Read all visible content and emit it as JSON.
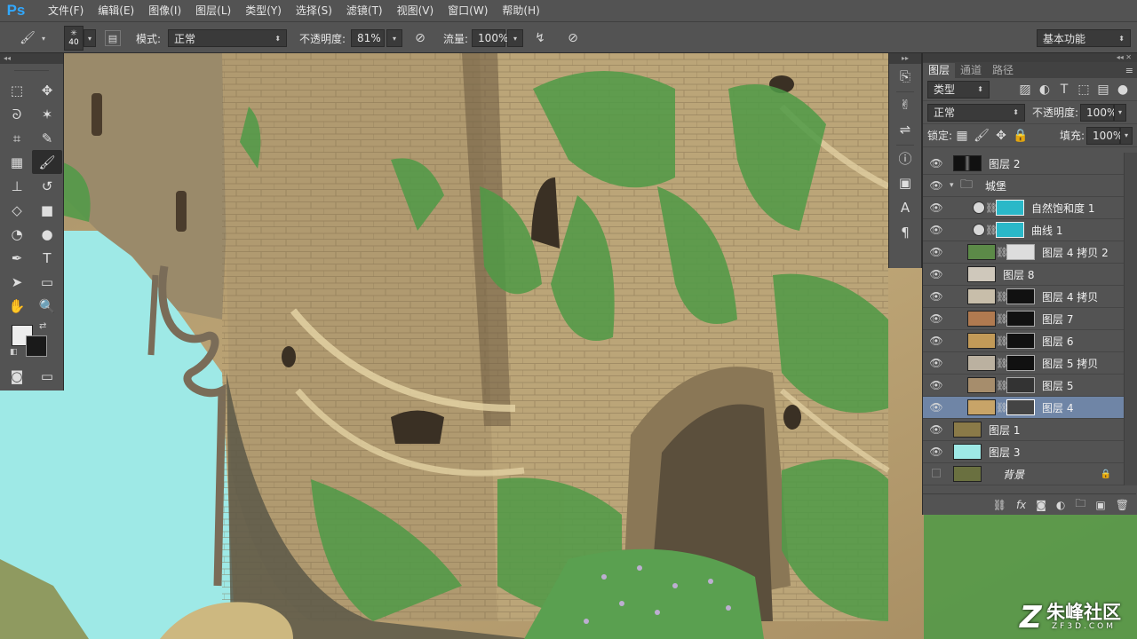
{
  "app": {
    "logo": "Ps"
  },
  "menu": [
    "文件(F)",
    "编辑(E)",
    "图像(I)",
    "图层(L)",
    "类型(Y)",
    "选择(S)",
    "滤镜(T)",
    "视图(V)",
    "窗口(W)",
    "帮助(H)"
  ],
  "options": {
    "brush_size": "40",
    "mode_label": "模式:",
    "mode_value": "正常",
    "opacity_label": "不透明度:",
    "opacity_value": "81%",
    "flow_label": "流量:",
    "flow_value": "100%",
    "workspace": "基本功能"
  },
  "layers_panel": {
    "tabs": [
      "图层",
      "通道",
      "路径"
    ],
    "filter_kind": "类型",
    "blend_mode": "正常",
    "opacity_label": "不透明度:",
    "opacity_value": "100%",
    "lock_label": "锁定:",
    "fill_label": "填充:",
    "fill_value": "100%",
    "layers": [
      {
        "name": "图层 2",
        "visible": true
      },
      {
        "name": "城堡",
        "visible": true,
        "type": "group"
      },
      {
        "name": "自然饱和度 1",
        "visible": true,
        "type": "adjustment"
      },
      {
        "name": "曲线 1",
        "visible": true,
        "type": "adjustment"
      },
      {
        "name": "图层 4 拷贝 2",
        "visible": true
      },
      {
        "name": "图层 8",
        "visible": true
      },
      {
        "name": "图层 4 拷贝",
        "visible": true
      },
      {
        "name": "图层 7",
        "visible": true
      },
      {
        "name": "图层 6",
        "visible": true
      },
      {
        "name": "图层 5 拷贝",
        "visible": true
      },
      {
        "name": "图层 5",
        "visible": true
      },
      {
        "name": "图层 4",
        "visible": true,
        "selected": true
      },
      {
        "name": "图层 1",
        "visible": true
      },
      {
        "name": "图层 3",
        "visible": true
      },
      {
        "name": "背景",
        "visible": false,
        "locked": true
      }
    ]
  },
  "watermark": {
    "main": "朱峰社区",
    "sub": "ZF3D.COM",
    "logo": "Z"
  },
  "colors": {
    "accent": "#31a8ff",
    "selection": "#6f85a6",
    "sky": "#9ee9e6",
    "wall": "#b8a278",
    "moss": "#4f9a46"
  }
}
